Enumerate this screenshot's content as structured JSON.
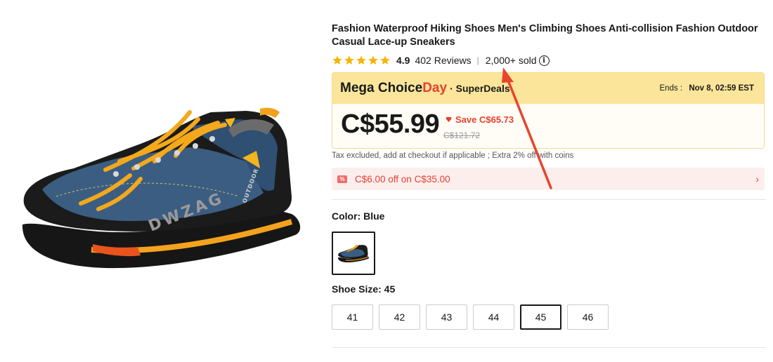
{
  "product": {
    "title": "Fashion Waterproof Hiking Shoes Men's Climbing Shoes Anti-collision Fashion Outdoor Casual Lace-up Sneakers",
    "image_alt_brand": "DWZAG",
    "image_alt_text2": "OUTDOOR"
  },
  "rating": {
    "stars": 5,
    "value": "4.9",
    "reviews": "402 Reviews",
    "separator": "|",
    "sold": "2,000+ sold",
    "info_glyph": "i"
  },
  "deal": {
    "brand_prefix": "Mega Choice",
    "brand_day": "Day",
    "brand_suffix": "· SuperDeals",
    "ends_label": "Ends :",
    "ends_time": "Nov 8, 02:59 EST",
    "price": "C$55.99",
    "save": "Save C$65.73",
    "original_price": "C$121.72"
  },
  "tax_note": "Tax excluded, add at checkout if applicable ; Extra 2% off with coins",
  "coupon": {
    "icon_glyph": "%",
    "text": "C$6.00 off on C$35.00",
    "chevron": "›"
  },
  "color": {
    "label": "Color: Blue",
    "selected_swatch": "Blue"
  },
  "size": {
    "label": "Shoe Size: 45",
    "options": [
      "41",
      "42",
      "43",
      "44",
      "45",
      "46"
    ],
    "selected": "45"
  },
  "colors": {
    "star": "#f7b500",
    "accent_red": "#e83f2d",
    "deal_header_bg": "#fbe59a",
    "coupon_bg": "#fdeeee",
    "arrow": "#e8442e"
  },
  "icons": {
    "star": "star-icon",
    "info": "info-icon",
    "save": "down-arrow-icon",
    "coupon": "coupon-icon",
    "chevron": "chevron-right-icon"
  }
}
